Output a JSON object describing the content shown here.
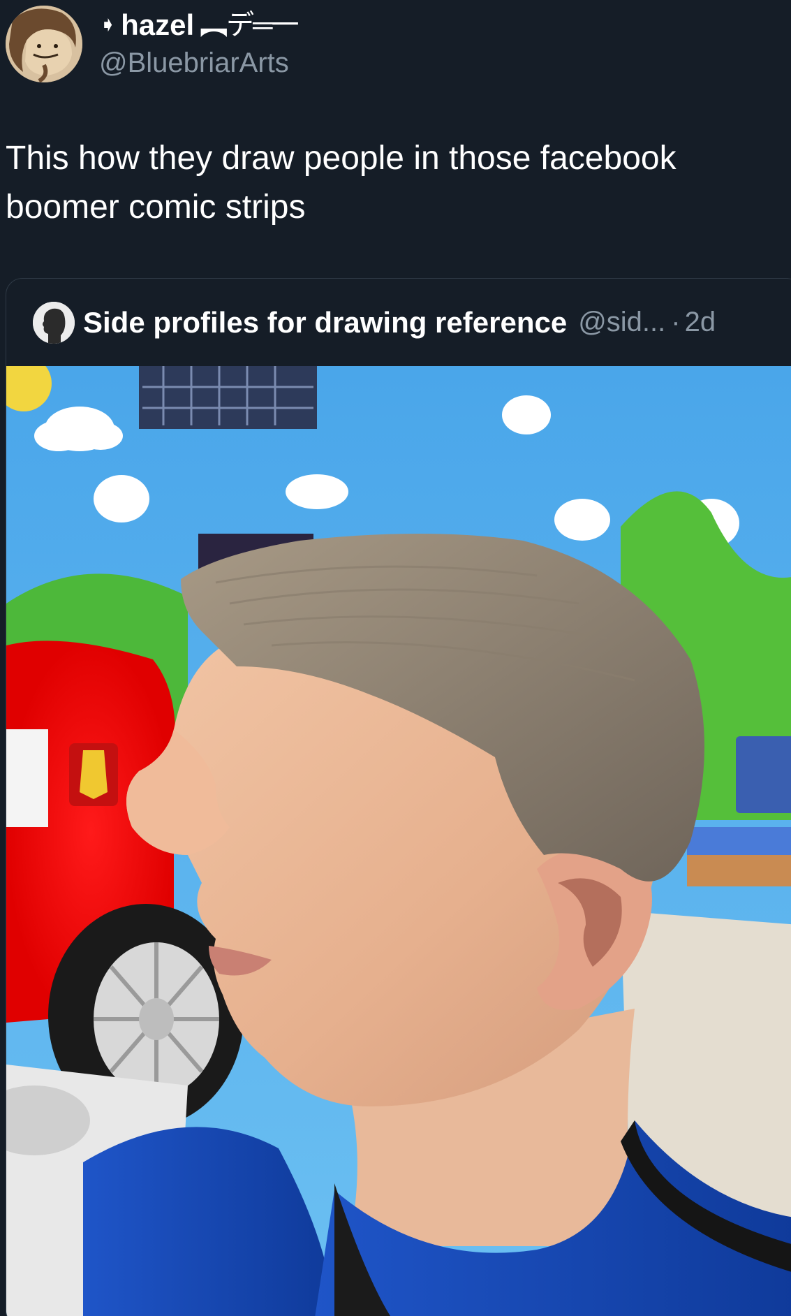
{
  "author": {
    "display_name": "hazel",
    "name_decoration": "︻デ═一",
    "handle": "@BluebriarArts",
    "avatar_icon": "profile-avatar-illustration"
  },
  "tweet": {
    "text": "This how they draw people in those facebook\nboomer comic strips"
  },
  "quoted_tweet": {
    "display_name": "Side profiles for drawing reference",
    "handle": "@sid...",
    "separator": "·",
    "time": "2d",
    "media_icon": "photo-side-profile-haircut"
  },
  "colors": {
    "background": "#151d27",
    "text_primary": "#ffffff",
    "text_secondary": "#8b98a5",
    "card_border": "#2f3a46"
  }
}
